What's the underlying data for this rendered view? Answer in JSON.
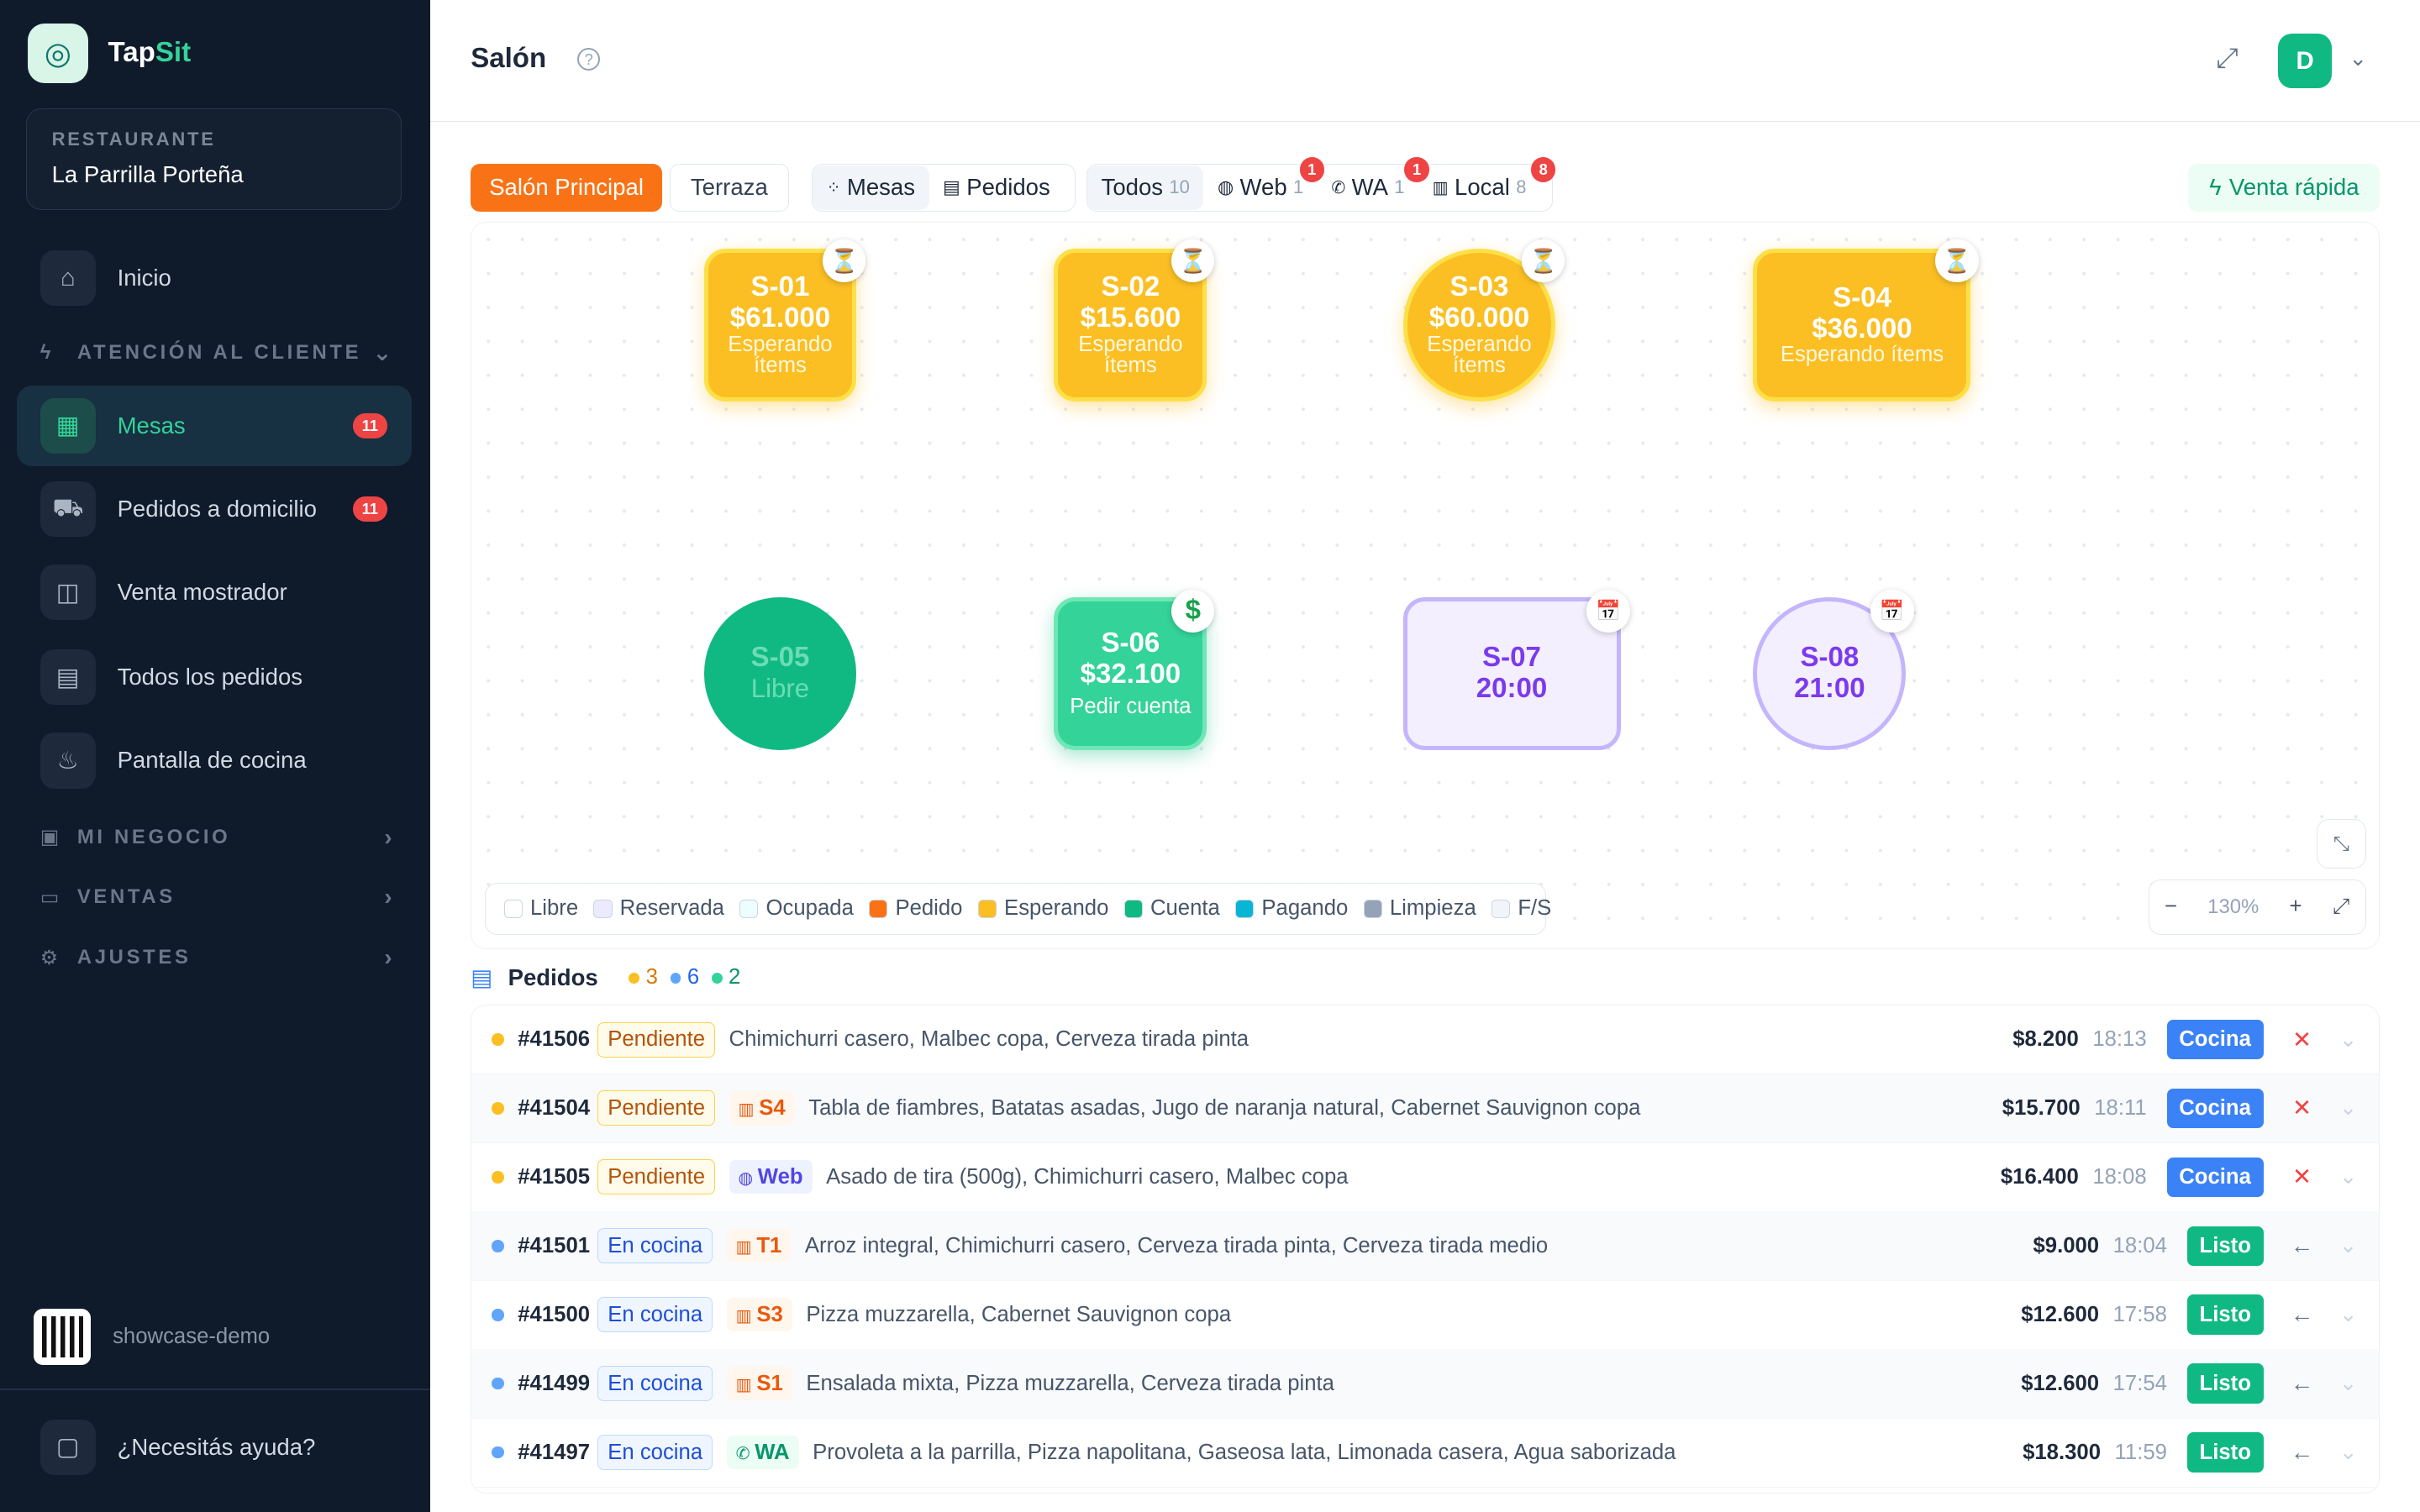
{
  "brand": {
    "name_a": "Tap",
    "name_b": "Sit"
  },
  "restaurant": {
    "label": "RESTAURANTE",
    "name": "La Parrilla Porteña"
  },
  "nav": {
    "inicio": "Inicio",
    "atencion": "ATENCIÓN AL CLIENTE",
    "mesas": "Mesas",
    "mesas_badge": "11",
    "pedidos_dom": "Pedidos a domicilio",
    "pedidos_dom_badge": "11",
    "venta_mostrador": "Venta mostrador",
    "todos_pedidos": "Todos los pedidos",
    "pantalla_cocina": "Pantalla de cocina",
    "mi_negocio": "MI NEGOCIO",
    "ventas": "VENTAS",
    "ajustes": "AJUSTES"
  },
  "footer": {
    "account": "showcase-demo",
    "help": "¿Necesitás ayuda?"
  },
  "header": {
    "title": "Salón",
    "avatar": "D"
  },
  "areas": {
    "salon": "Salón Principal",
    "terraza": "Terraza"
  },
  "view": {
    "mesas": "Mesas",
    "pedidos": "Pedidos"
  },
  "filters": {
    "todos": "Todos",
    "todos_n": "10",
    "web": "Web",
    "web_n": "1",
    "web_badge": "1",
    "wa": "WA",
    "wa_n": "1",
    "wa_badge": "1",
    "local": "Local",
    "local_n": "8",
    "local_badge": "8"
  },
  "venta_rapida": "Venta rápida",
  "tables": [
    {
      "id": "S-01",
      "amount": "$61.000",
      "status": "Esperando ítems",
      "icon": "hourglass-icon"
    },
    {
      "id": "S-02",
      "amount": "$15.600",
      "status": "Esperando ítems",
      "icon": "hourglass-icon"
    },
    {
      "id": "S-03",
      "amount": "$60.000",
      "status": "Esperando ítems",
      "icon": "hourglass-icon"
    },
    {
      "id": "S-04",
      "amount": "$36.000",
      "status": "Esperando ítems",
      "icon": "hourglass-icon"
    },
    {
      "id": "S-05",
      "status": "Libre"
    },
    {
      "id": "S-06",
      "amount": "$32.100",
      "status": "Pedir cuenta",
      "icon": "dollar-icon"
    },
    {
      "id": "S-07",
      "time": "20:00",
      "icon": "calendar-icon"
    },
    {
      "id": "S-08",
      "time": "21:00",
      "icon": "calendar-icon"
    }
  ],
  "legend": [
    "Libre",
    "Reservada",
    "Ocupada",
    "Pedido",
    "Esperando",
    "Cuenta",
    "Pagando",
    "Limpieza",
    "F/S"
  ],
  "legend_colors": [
    "#ffffff",
    "#ede9fe",
    "#ecfeff",
    "#f97316",
    "#fbbf24",
    "#10b981",
    "#06b6d4",
    "#94a3b8",
    "#f1f5f9"
  ],
  "zoom": {
    "value": "130%",
    "minus": "−",
    "plus": "+"
  },
  "orders_header": {
    "title": "Pedidos",
    "c1": "3",
    "c2": "6",
    "c3": "2"
  },
  "orders": [
    {
      "num": "#41506",
      "state": "Pendiente",
      "source": "",
      "items": "Chimichurri casero, Malbec copa, Cerveza tirada pinta",
      "total": "$8.200",
      "time": "18:13",
      "action": "Cocina"
    },
    {
      "num": "#41504",
      "state": "Pendiente",
      "source": "S4",
      "items": "Tabla de fiambres, Batatas asadas, Jugo de naranja natural, Cabernet Sauvignon copa",
      "total": "$15.700",
      "time": "18:11",
      "action": "Cocina"
    },
    {
      "num": "#41505",
      "state": "Pendiente",
      "source": "Web",
      "items": "Asado de tira (500g), Chimichurri casero, Malbec copa",
      "total": "$16.400",
      "time": "18:08",
      "action": "Cocina"
    },
    {
      "num": "#41501",
      "state": "En cocina",
      "source": "T1",
      "items": "Arroz integral, Chimichurri casero, Cerveza tirada pinta, Cerveza tirada medio",
      "total": "$9.000",
      "time": "18:04",
      "action": "Listo"
    },
    {
      "num": "#41500",
      "state": "En cocina",
      "source": "S3",
      "items": "Pizza muzzarella, Cabernet Sauvignon copa",
      "total": "$12.600",
      "time": "17:58",
      "action": "Listo"
    },
    {
      "num": "#41499",
      "state": "En cocina",
      "source": "S1",
      "items": "Ensalada mixta, Pizza muzzarella, Cerveza tirada pinta",
      "total": "$12.600",
      "time": "17:54",
      "action": "Listo"
    },
    {
      "num": "#41497",
      "state": "En cocina",
      "source": "WA",
      "items": "Provoleta a la parrilla, Pizza napolitana, Gaseosa lata, Limonada casera, Agua saborizada",
      "total": "$18.300",
      "time": "11:59",
      "action": "Listo"
    }
  ]
}
